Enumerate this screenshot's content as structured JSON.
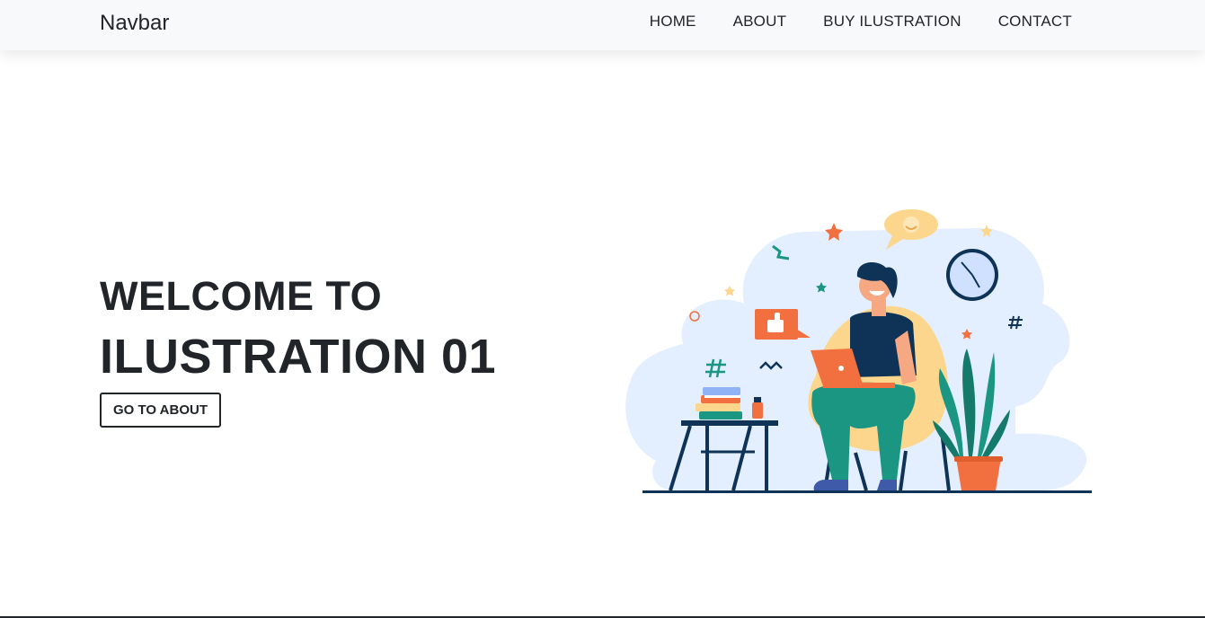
{
  "navbar": {
    "brand": "Navbar",
    "links": [
      "HOME",
      "ABOUT",
      "BUY ILUSTRATION",
      "CONTACT"
    ]
  },
  "hero": {
    "line1": "WELCOME TO",
    "line2": "ILUSTRATION 01",
    "button_label": "GO TO ABOUT"
  },
  "colors": {
    "navbar_bg": "#f8f9fa",
    "text": "#212529",
    "blob": "#e3efff",
    "orange": "#f2703f",
    "teal": "#1a9683",
    "navy": "#0e3356",
    "chair": "#fbd68c"
  },
  "illustration": {
    "icons": [
      "person-with-laptop-icon",
      "clock-icon",
      "thumbs-up-icon",
      "plant-icon",
      "books-icon",
      "speech-bubble-icon"
    ]
  }
}
